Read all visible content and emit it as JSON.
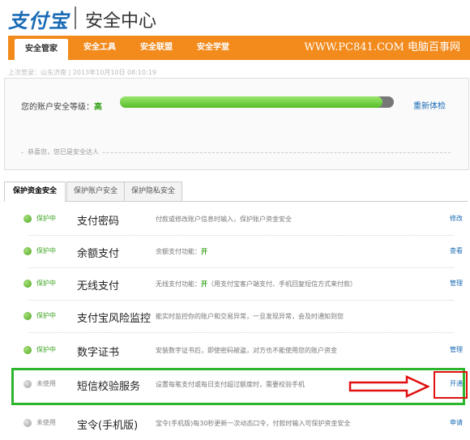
{
  "header": {
    "logo": "支付宝",
    "title": "安全中心"
  },
  "nav": {
    "tabs": [
      {
        "label": "安全管家",
        "active": true
      },
      {
        "label": "安全工具",
        "active": false
      },
      {
        "label": "安全联盟",
        "active": false
      },
      {
        "label": "安全学堂",
        "active": false
      }
    ],
    "watermark": "WWW.PC841.COM 电脑百事网"
  },
  "login_info": "上次登录：山东济南 | 2013年10月10日 08:10:19",
  "security": {
    "label": "您的账户安全等级：",
    "level": "高",
    "progress": 0.96,
    "recheck": "重新体检",
    "congrats": "恭喜您，您已是安全达人"
  },
  "subtabs": [
    {
      "label": "保护资金安全",
      "active": true
    },
    {
      "label": "保护账户安全",
      "active": false
    },
    {
      "label": "保护隐私安全",
      "active": false
    }
  ],
  "items": [
    {
      "status": "保护中",
      "on": true,
      "name": "支付密码",
      "desc": "付款或修改账户信息时输入，保护账户资金安全",
      "action": "修改"
    },
    {
      "status": "保护中",
      "on": true,
      "name": "余额支付",
      "desc_pre": "余额支付功能：",
      "desc_hl": "开",
      "desc_post": "",
      "action": "查看"
    },
    {
      "status": "保护中",
      "on": true,
      "name": "无线支付",
      "desc_pre": "无线支付功能：",
      "desc_hl": "开",
      "desc_post": "（用支付宝客户端支付、手机回复短信方式来付款）",
      "action": "管理"
    },
    {
      "status": "保护中",
      "on": true,
      "name": "支付宝风险监控",
      "desc": "能实时监控你的账户和交易异常，一旦发现异常，会及时通知到您",
      "action": ""
    },
    {
      "status": "保护中",
      "on": true,
      "name": "数字证书",
      "desc": "安装数字证书后，即使密码被盗，对方也不能使用您的账户资金",
      "action": "管理"
    },
    {
      "status": "未使用",
      "on": false,
      "name": "短信校验服务",
      "desc": "设置每笔支付或每日支付超过额度时，需要校验手机",
      "action": "开通"
    },
    {
      "status": "未使用",
      "on": false,
      "name": "宝令(手机版)",
      "desc": "宝令(手机版)每30秒更新一次动态口令，付款时输入可保护资金安全",
      "action": "申请"
    }
  ],
  "colors": {
    "nav_orange": "#f28a1c",
    "status_green": "#3aa320",
    "link_blue": "#1a6bb5",
    "highlight_green": "#2eb52e",
    "arrow_red": "#e01010"
  }
}
